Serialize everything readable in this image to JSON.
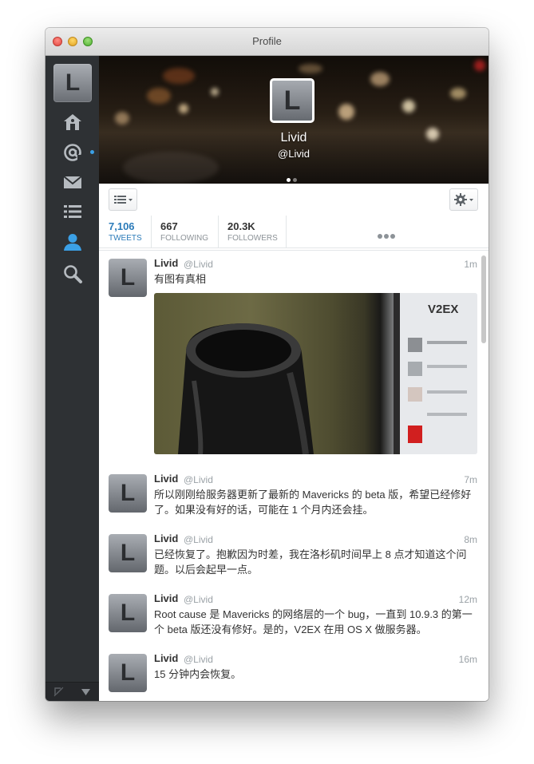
{
  "window": {
    "title": "Profile"
  },
  "sidebar": {
    "avatar_letter": "L",
    "items": [
      {
        "icon": "home-icon"
      },
      {
        "icon": "mentions-icon"
      },
      {
        "icon": "messages-icon"
      },
      {
        "icon": "lists-icon"
      },
      {
        "icon": "profile-icon"
      },
      {
        "icon": "search-icon"
      }
    ],
    "active_item": "profile-icon",
    "mentions_unread": true
  },
  "profile": {
    "name": "Livid",
    "handle": "@Livid",
    "avatar_letter": "L",
    "banner_pages": 2,
    "banner_current_page": 1
  },
  "stats": [
    {
      "value": "7,106",
      "label": "TWEETS",
      "active": true
    },
    {
      "value": "667",
      "label": "FOLLOWING",
      "active": false
    },
    {
      "value": "20.3K",
      "label": "FOLLOWERS",
      "active": false
    }
  ],
  "colors": {
    "accent": "#2b7bb9",
    "sidebar": "#2e3134",
    "unread": "#3ba0e6"
  },
  "tweets": [
    {
      "name": "Livid",
      "handle": "@Livid",
      "time": "1m",
      "text": "有图有真相",
      "has_media": true
    },
    {
      "name": "Livid",
      "handle": "@Livid",
      "time": "7m",
      "text": "所以刚刚给服务器更新了最新的 Mavericks 的 beta 版，希望已经修好了。如果没有好的话，可能在 1 个月内还会挂。",
      "has_media": false
    },
    {
      "name": "Livid",
      "handle": "@Livid",
      "time": "8m",
      "text": "已经恢复了。抱歉因为时差，我在洛杉矶时间早上 8 点才知道这个问题。以后会起早一点。",
      "has_media": false
    },
    {
      "name": "Livid",
      "handle": "@Livid",
      "time": "12m",
      "text": "Root cause 是 Mavericks 的网络层的一个 bug，一直到 10.9.3 的第一个 beta 版还没有修好。是的，V2EX 在用 OS X 做服务器。",
      "has_media": false
    },
    {
      "name": "Livid",
      "handle": "@Livid",
      "time": "16m",
      "text": "15 分钟内会恢复。",
      "has_media": false
    }
  ],
  "media": {
    "screen_text": "V2EX"
  }
}
